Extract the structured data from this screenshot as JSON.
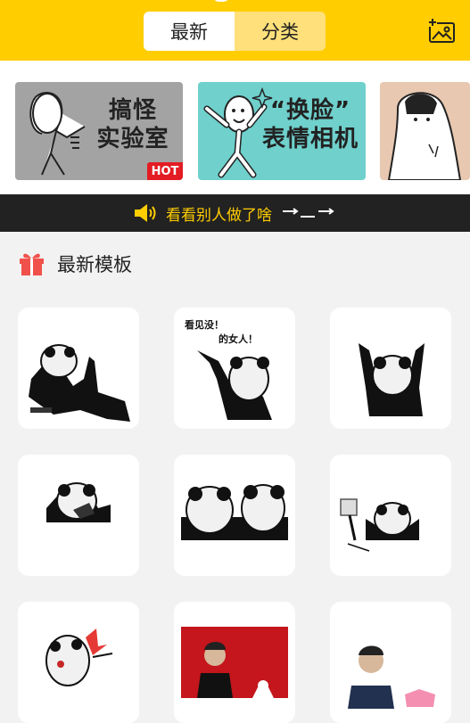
{
  "header": {
    "tabs": [
      {
        "label": "最新",
        "active": true
      },
      {
        "label": "分类",
        "active": false
      }
    ],
    "gallery_icon": "image-add-icon",
    "accent": "#ffcd00"
  },
  "banner": {
    "cards": [
      {
        "title_line1": "搞怪",
        "title_line2": "实验室",
        "badge": "HOT",
        "bg": "#a3a3a3"
      },
      {
        "title_line1": "“换脸”",
        "title_line2": "表情相机",
        "bg": "#6fd0cc"
      },
      {
        "bg": "#e8c8b0"
      }
    ]
  },
  "notice": {
    "icon": "speaker-icon",
    "text": "看看别人做了啥"
  },
  "section": {
    "icon": "gift-icon",
    "title": "最新模板"
  },
  "templates": [
    {
      "caption": ""
    },
    {
      "caption_line1": "看见没！",
      "caption_line2": "的女人！"
    },
    {
      "caption": ""
    },
    {
      "caption": ""
    },
    {
      "caption": ""
    },
    {
      "caption": ""
    },
    {
      "caption": ""
    },
    {
      "caption": ""
    },
    {
      "caption": ""
    }
  ]
}
